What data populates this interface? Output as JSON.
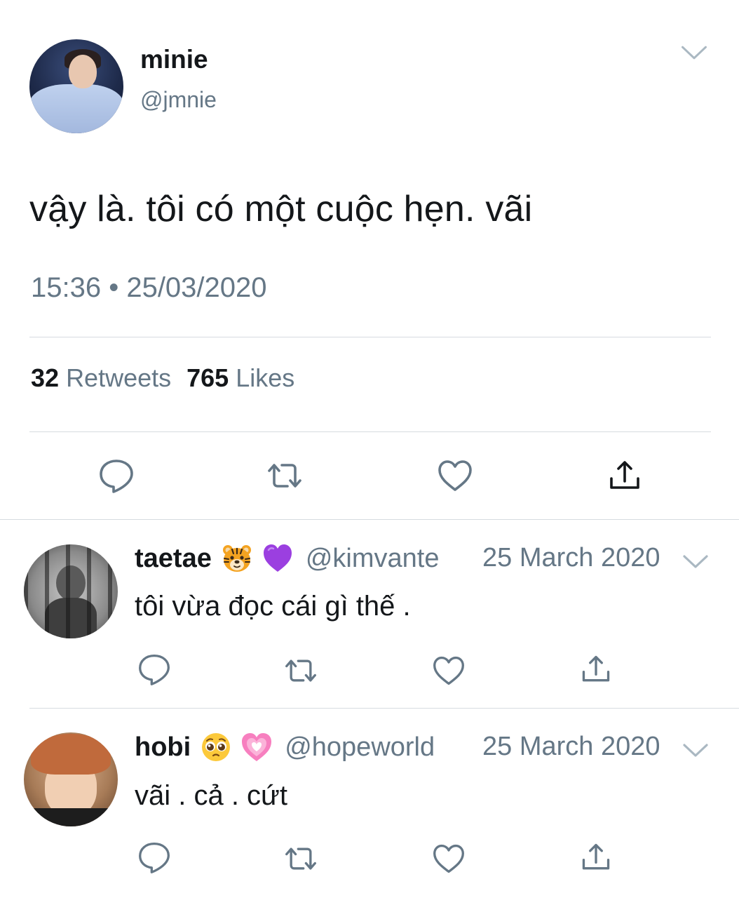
{
  "tweet": {
    "author": {
      "display_name": "minie",
      "handle": "@jmnie",
      "avatar": "profile-photo"
    },
    "text": "vậy là. tôi có một cuộc hẹn. vãi",
    "timestamp": "15:36 • 25/03/2020",
    "retweets_count": "32",
    "retweets_label": "Retweets",
    "likes_count": "765",
    "likes_label": "Likes",
    "actions": [
      "reply-icon",
      "retweet-icon",
      "like-icon",
      "share-icon"
    ]
  },
  "replies": [
    {
      "display_name": "taetae",
      "emojis": [
        "tiger-face-emoji",
        "purple-heart-emoji"
      ],
      "handle": "@kimvante",
      "date": "25 March 2020",
      "text": "tôi vừa đọc cái gì thế ."
    },
    {
      "display_name": "hobi",
      "emojis": [
        "pleading-face-emoji",
        "growing-heart-emoji"
      ],
      "handle": "@hopeworld",
      "date": "25 March 2020",
      "text": "vãi . cả . cứt"
    }
  ],
  "colors": {
    "text_primary": "#14171a",
    "text_secondary": "#657786",
    "icon": "#657786",
    "divider": "#d6dbe0"
  }
}
